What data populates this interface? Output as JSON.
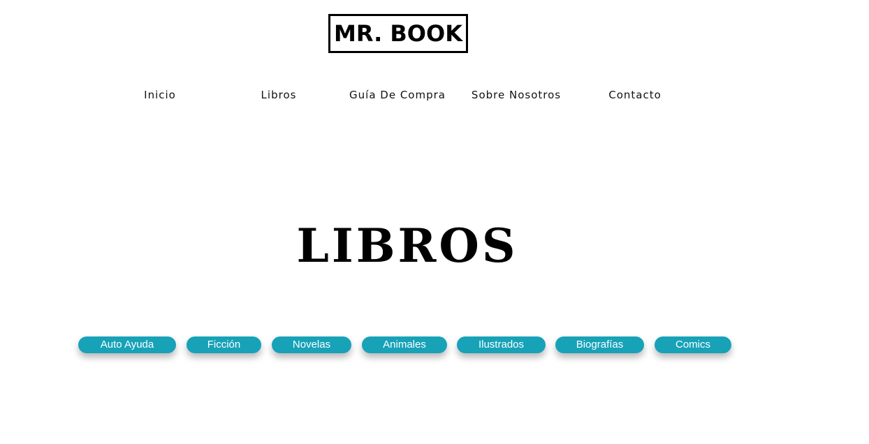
{
  "header": {
    "logo_text": "MR. BOOK"
  },
  "nav": {
    "items": [
      {
        "label": "Inicio"
      },
      {
        "label": "Libros"
      },
      {
        "label": "Guía De Compra"
      },
      {
        "label": "Sobre Nosotros"
      },
      {
        "label": "Contacto"
      }
    ]
  },
  "main": {
    "title": "LIBROS",
    "categories": [
      {
        "label": "Auto Ayuda"
      },
      {
        "label": "Ficción"
      },
      {
        "label": "Novelas"
      },
      {
        "label": "Animales"
      },
      {
        "label": "Ilustrados"
      },
      {
        "label": "Biografías"
      },
      {
        "label": "Comics"
      }
    ]
  },
  "colors": {
    "accent": "#17a2b8",
    "background": "#ffffff",
    "text": "#111111"
  }
}
